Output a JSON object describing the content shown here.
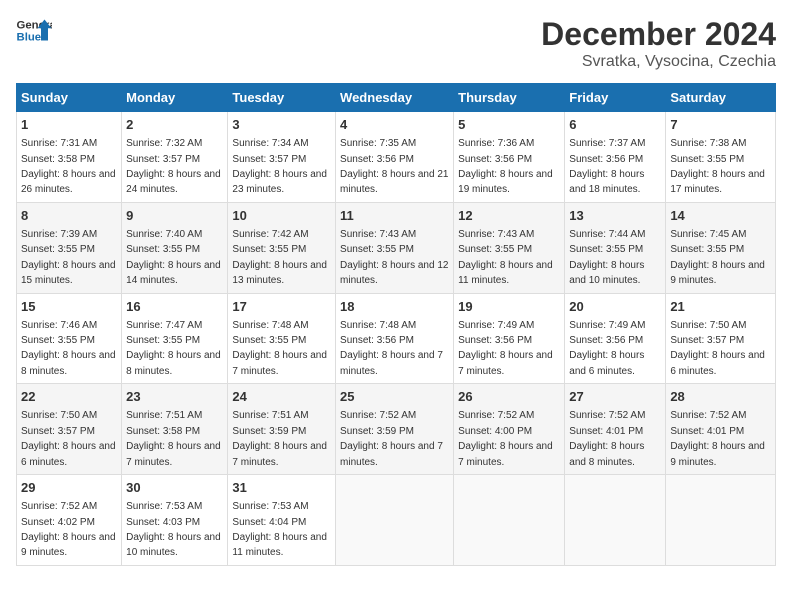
{
  "header": {
    "logo_line1": "General",
    "logo_line2": "Blue",
    "title": "December 2024",
    "subtitle": "Svratka, Vysocina, Czechia"
  },
  "weekdays": [
    "Sunday",
    "Monday",
    "Tuesday",
    "Wednesday",
    "Thursday",
    "Friday",
    "Saturday"
  ],
  "weeks": [
    [
      {
        "day": "1",
        "sunrise": "7:31 AM",
        "sunset": "3:58 PM",
        "daylight": "8 hours and 26 minutes."
      },
      {
        "day": "2",
        "sunrise": "7:32 AM",
        "sunset": "3:57 PM",
        "daylight": "8 hours and 24 minutes."
      },
      {
        "day": "3",
        "sunrise": "7:34 AM",
        "sunset": "3:57 PM",
        "daylight": "8 hours and 23 minutes."
      },
      {
        "day": "4",
        "sunrise": "7:35 AM",
        "sunset": "3:56 PM",
        "daylight": "8 hours and 21 minutes."
      },
      {
        "day": "5",
        "sunrise": "7:36 AM",
        "sunset": "3:56 PM",
        "daylight": "8 hours and 19 minutes."
      },
      {
        "day": "6",
        "sunrise": "7:37 AM",
        "sunset": "3:56 PM",
        "daylight": "8 hours and 18 minutes."
      },
      {
        "day": "7",
        "sunrise": "7:38 AM",
        "sunset": "3:55 PM",
        "daylight": "8 hours and 17 minutes."
      }
    ],
    [
      {
        "day": "8",
        "sunrise": "7:39 AM",
        "sunset": "3:55 PM",
        "daylight": "8 hours and 15 minutes."
      },
      {
        "day": "9",
        "sunrise": "7:40 AM",
        "sunset": "3:55 PM",
        "daylight": "8 hours and 14 minutes."
      },
      {
        "day": "10",
        "sunrise": "7:42 AM",
        "sunset": "3:55 PM",
        "daylight": "8 hours and 13 minutes."
      },
      {
        "day": "11",
        "sunrise": "7:43 AM",
        "sunset": "3:55 PM",
        "daylight": "8 hours and 12 minutes."
      },
      {
        "day": "12",
        "sunrise": "7:43 AM",
        "sunset": "3:55 PM",
        "daylight": "8 hours and 11 minutes."
      },
      {
        "day": "13",
        "sunrise": "7:44 AM",
        "sunset": "3:55 PM",
        "daylight": "8 hours and 10 minutes."
      },
      {
        "day": "14",
        "sunrise": "7:45 AM",
        "sunset": "3:55 PM",
        "daylight": "8 hours and 9 minutes."
      }
    ],
    [
      {
        "day": "15",
        "sunrise": "7:46 AM",
        "sunset": "3:55 PM",
        "daylight": "8 hours and 8 minutes."
      },
      {
        "day": "16",
        "sunrise": "7:47 AM",
        "sunset": "3:55 PM",
        "daylight": "8 hours and 8 minutes."
      },
      {
        "day": "17",
        "sunrise": "7:48 AM",
        "sunset": "3:55 PM",
        "daylight": "8 hours and 7 minutes."
      },
      {
        "day": "18",
        "sunrise": "7:48 AM",
        "sunset": "3:56 PM",
        "daylight": "8 hours and 7 minutes."
      },
      {
        "day": "19",
        "sunrise": "7:49 AM",
        "sunset": "3:56 PM",
        "daylight": "8 hours and 7 minutes."
      },
      {
        "day": "20",
        "sunrise": "7:49 AM",
        "sunset": "3:56 PM",
        "daylight": "8 hours and 6 minutes."
      },
      {
        "day": "21",
        "sunrise": "7:50 AM",
        "sunset": "3:57 PM",
        "daylight": "8 hours and 6 minutes."
      }
    ],
    [
      {
        "day": "22",
        "sunrise": "7:50 AM",
        "sunset": "3:57 PM",
        "daylight": "8 hours and 6 minutes."
      },
      {
        "day": "23",
        "sunrise": "7:51 AM",
        "sunset": "3:58 PM",
        "daylight": "8 hours and 7 minutes."
      },
      {
        "day": "24",
        "sunrise": "7:51 AM",
        "sunset": "3:59 PM",
        "daylight": "8 hours and 7 minutes."
      },
      {
        "day": "25",
        "sunrise": "7:52 AM",
        "sunset": "3:59 PM",
        "daylight": "8 hours and 7 minutes."
      },
      {
        "day": "26",
        "sunrise": "7:52 AM",
        "sunset": "4:00 PM",
        "daylight": "8 hours and 7 minutes."
      },
      {
        "day": "27",
        "sunrise": "7:52 AM",
        "sunset": "4:01 PM",
        "daylight": "8 hours and 8 minutes."
      },
      {
        "day": "28",
        "sunrise": "7:52 AM",
        "sunset": "4:01 PM",
        "daylight": "8 hours and 9 minutes."
      }
    ],
    [
      {
        "day": "29",
        "sunrise": "7:52 AM",
        "sunset": "4:02 PM",
        "daylight": "8 hours and 9 minutes."
      },
      {
        "day": "30",
        "sunrise": "7:53 AM",
        "sunset": "4:03 PM",
        "daylight": "8 hours and 10 minutes."
      },
      {
        "day": "31",
        "sunrise": "7:53 AM",
        "sunset": "4:04 PM",
        "daylight": "8 hours and 11 minutes."
      },
      null,
      null,
      null,
      null
    ]
  ]
}
